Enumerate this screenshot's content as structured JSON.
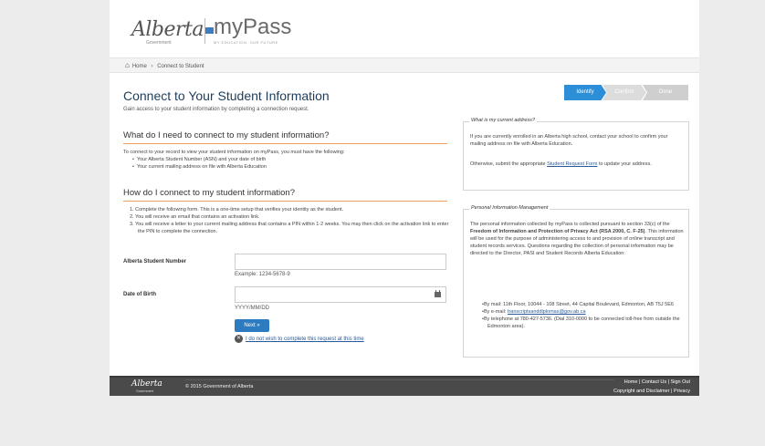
{
  "header": {
    "logo_alberta": "Alberta",
    "logo_government": "Government",
    "logo_mypass": "myPass",
    "logo_tagline": "MY EDUCATION, OUR FUTURE"
  },
  "breadcrumb": {
    "home": "Home",
    "separator": "›",
    "current": "Connect to Student"
  },
  "main": {
    "title": "Connect to Your Student Information",
    "subtitle": "Gain access to your student information by completing a connection request.",
    "section1_heading": "What do I need to connect to my student information?",
    "section1_intro": "To connect to your record to view your student information on myPass, you must have the following:",
    "section1_bullets": [
      "Your Alberta Student Number (ASN) and your date of birth",
      "Your current mailing address on file with Alberta Education"
    ],
    "section2_heading": "How do I connect to my student information?",
    "section2_steps": [
      "1.  Complete the following form. This is a one-time setup that verifies your identity as the student.",
      "2.  You will receive an email that contains an activation link.",
      "3.  You will receive a letter to your current mailing address that contains a PIN within 1-2 weeks. You may then click on the activation link to enter the PIN to complete the connection."
    ],
    "asn_label": "Alberta Student Number",
    "asn_hint": "Example: 1234-5678-9",
    "dob_label": "Date of Birth",
    "dob_hint": "YYYY/MM/DD",
    "next_button": "Next »",
    "cancel_link": "I do not wish to complete this request at this time"
  },
  "progress": {
    "steps": [
      "Identify",
      "Confirm",
      "Done"
    ],
    "active_index": 0
  },
  "sidebar": {
    "address_box": {
      "legend": "What is my current address?",
      "para1": "If you are currently enrolled in an Alberta high school, contact your school to confirm your mailing address on file with Alberta Education.",
      "para2_before": "Otherwise, submit the appropriate ",
      "para2_link": "Student Request Form",
      "para2_after": " to update your address."
    },
    "privacy_box": {
      "legend": "Personal Information Management",
      "para1_a": "The personal information collected by myPass is collected pursuant to section 33(c) of the ",
      "para1_bold": "Freedom of Information and Protection of Privacy Act (RSA 2000, C. F-25)",
      "para1_b": ". This information will be used for the purpose of administering access to and provision of online transcript and student records services. Questions regarding the collection of personal information may be directed to the Director, PASI and Student Records Alberta Education:",
      "bullet_mail": "By mail: 11th Floor, 10044 - 108 Street, 44 Capital Boulevard, Edmonton, AB T5J 5E6",
      "bullet_email_label": "By e-mail: ",
      "bullet_email": "transcriptsanddiplomas@gov.ab.ca",
      "bullet_phone": "By telephone at 780-427-5736. (Dial 310-0000 to be connected toll-free from outside the Edmonton area)."
    }
  },
  "footer": {
    "logo": "Alberta",
    "government": "Government",
    "copyright": "© 2015 Government of Alberta",
    "links_row1": "Home | Contact Us | Sign Out",
    "links_row2": "Copyright and Disclaimer | Privacy"
  },
  "colors": {
    "accent_blue": "#2d8ed8",
    "button_blue": "#2d7cc1",
    "heading_rule": "#f0a060",
    "footer_bg": "#4a4a4a"
  }
}
